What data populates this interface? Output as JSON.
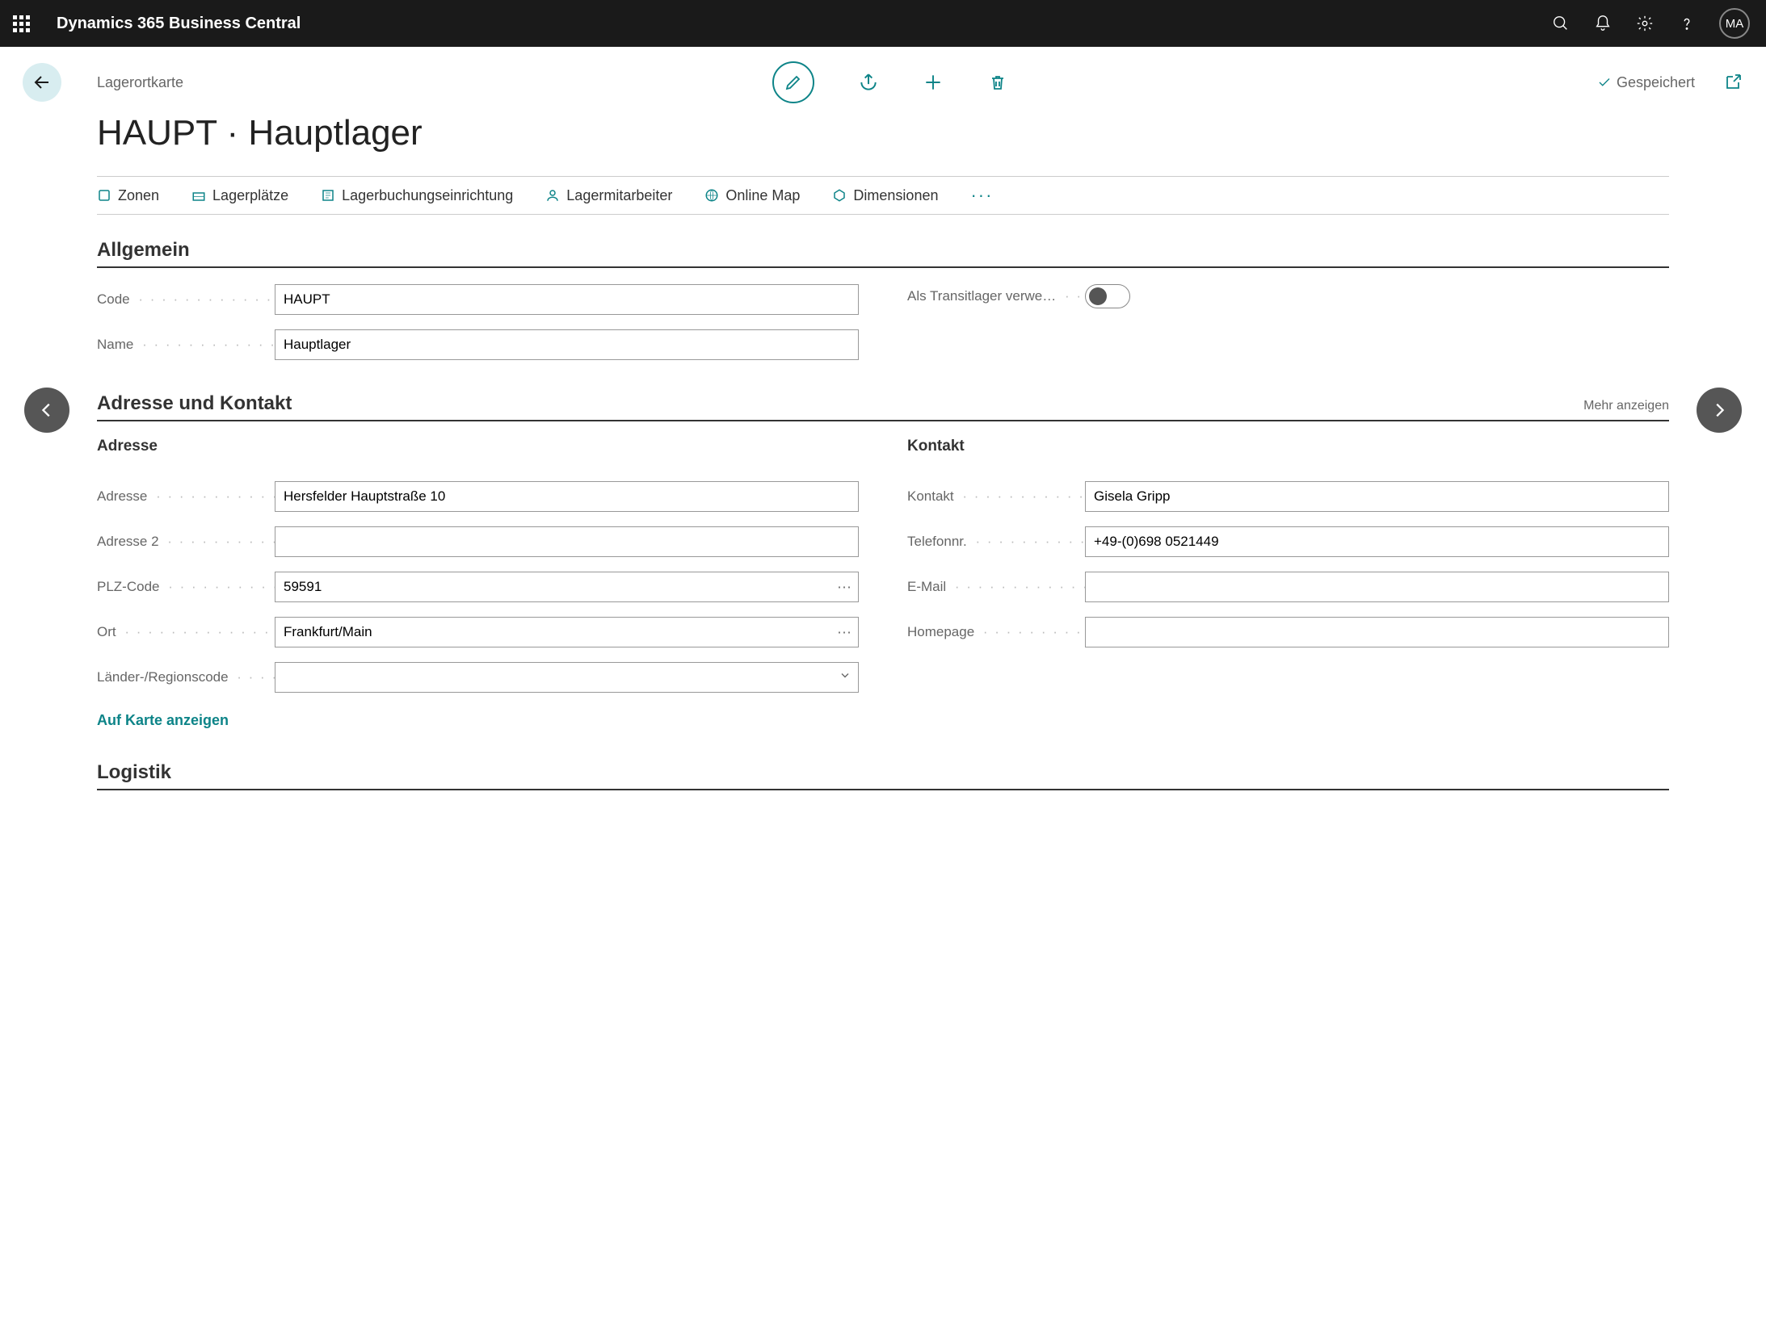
{
  "app": {
    "title": "Dynamics 365 Business Central",
    "user_initials": "MA"
  },
  "header": {
    "breadcrumb": "Lagerortkarte",
    "saved_status": "Gespeichert",
    "page_title": "HAUPT · Hauptlager"
  },
  "tabs": [
    {
      "label": "Zonen"
    },
    {
      "label": "Lagerplätze"
    },
    {
      "label": "Lagerbuchungseinrichtung"
    },
    {
      "label": "Lagermitarbeiter"
    },
    {
      "label": "Online Map"
    },
    {
      "label": "Dimensionen"
    }
  ],
  "sections": {
    "allgemein": {
      "title": "Allgemein",
      "fields": {
        "code": {
          "label": "Code",
          "value": "HAUPT"
        },
        "name": {
          "label": "Name",
          "value": "Hauptlager"
        },
        "transit": {
          "label": "Als Transitlager verwe…",
          "value": false
        }
      }
    },
    "adresse_kontakt": {
      "title": "Adresse und Kontakt",
      "more": "Mehr anzeigen",
      "adresse": {
        "heading": "Adresse",
        "fields": {
          "adresse": {
            "label": "Adresse",
            "value": "Hersfelder Hauptstraße 10"
          },
          "adresse2": {
            "label": "Adresse 2",
            "value": ""
          },
          "plz": {
            "label": "PLZ-Code",
            "value": "59591"
          },
          "ort": {
            "label": "Ort",
            "value": "Frankfurt/Main"
          },
          "land": {
            "label": "Länder-/Regionscode",
            "value": ""
          }
        },
        "map_link": "Auf Karte anzeigen"
      },
      "kontakt": {
        "heading": "Kontakt",
        "fields": {
          "kontakt": {
            "label": "Kontakt",
            "value": "Gisela Gripp"
          },
          "telefon": {
            "label": "Telefonnr.",
            "value": "+49-(0)698 0521449"
          },
          "email": {
            "label": "E-Mail",
            "value": ""
          },
          "homepage": {
            "label": "Homepage",
            "value": ""
          }
        }
      }
    },
    "logistik": {
      "title": "Logistik"
    }
  }
}
